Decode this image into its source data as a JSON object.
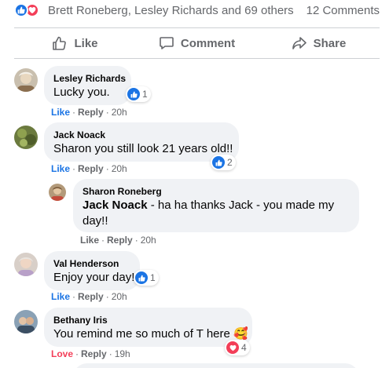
{
  "summary": {
    "names": "Brett Roneberg, Lesley Richards and 69 others",
    "comment_count": "12 Comments"
  },
  "actions": {
    "like": "Like",
    "comment": "Comment",
    "share": "Share"
  },
  "comments": [
    {
      "author": "Lesley Richards",
      "text": "Lucky you.",
      "like_label": "Like",
      "reply_label": "Reply",
      "time": "20h",
      "reaction_count": "1",
      "reaction": "like-icon"
    },
    {
      "author": "Jack Noack",
      "text": "Sharon you still look 21 years old!!",
      "like_label": "Like",
      "reply_label": "Reply",
      "time": "20h",
      "reaction_count": "2",
      "reaction": "like-icon"
    },
    {
      "author": "Sharon Roneberg",
      "mention": "Jack Noack",
      "text_line1": " - ha ha thanks Jack - you made my",
      "text_line2": "day!!",
      "like_label": "Like",
      "reply_label": "Reply",
      "time": "20h"
    },
    {
      "author": "Val Henderson",
      "text": "Enjoy your day!",
      "like_label": "Like",
      "reply_label": "Reply",
      "time": "20h",
      "reaction_count": "1",
      "reaction": "like-icon"
    },
    {
      "author": "Bethany Iris",
      "text": "You remind me so much of T here",
      "emoji": "🥰",
      "like_label": "Love",
      "reply_label": "Reply",
      "time": "19h",
      "reaction_count": "4",
      "reaction": "heart-icon"
    }
  ],
  "colors": {
    "like_blue": "#1b74e4",
    "love_red": "#f33e58",
    "bubble_gray": "#f0f2f5",
    "meta_gray": "#65676b"
  }
}
